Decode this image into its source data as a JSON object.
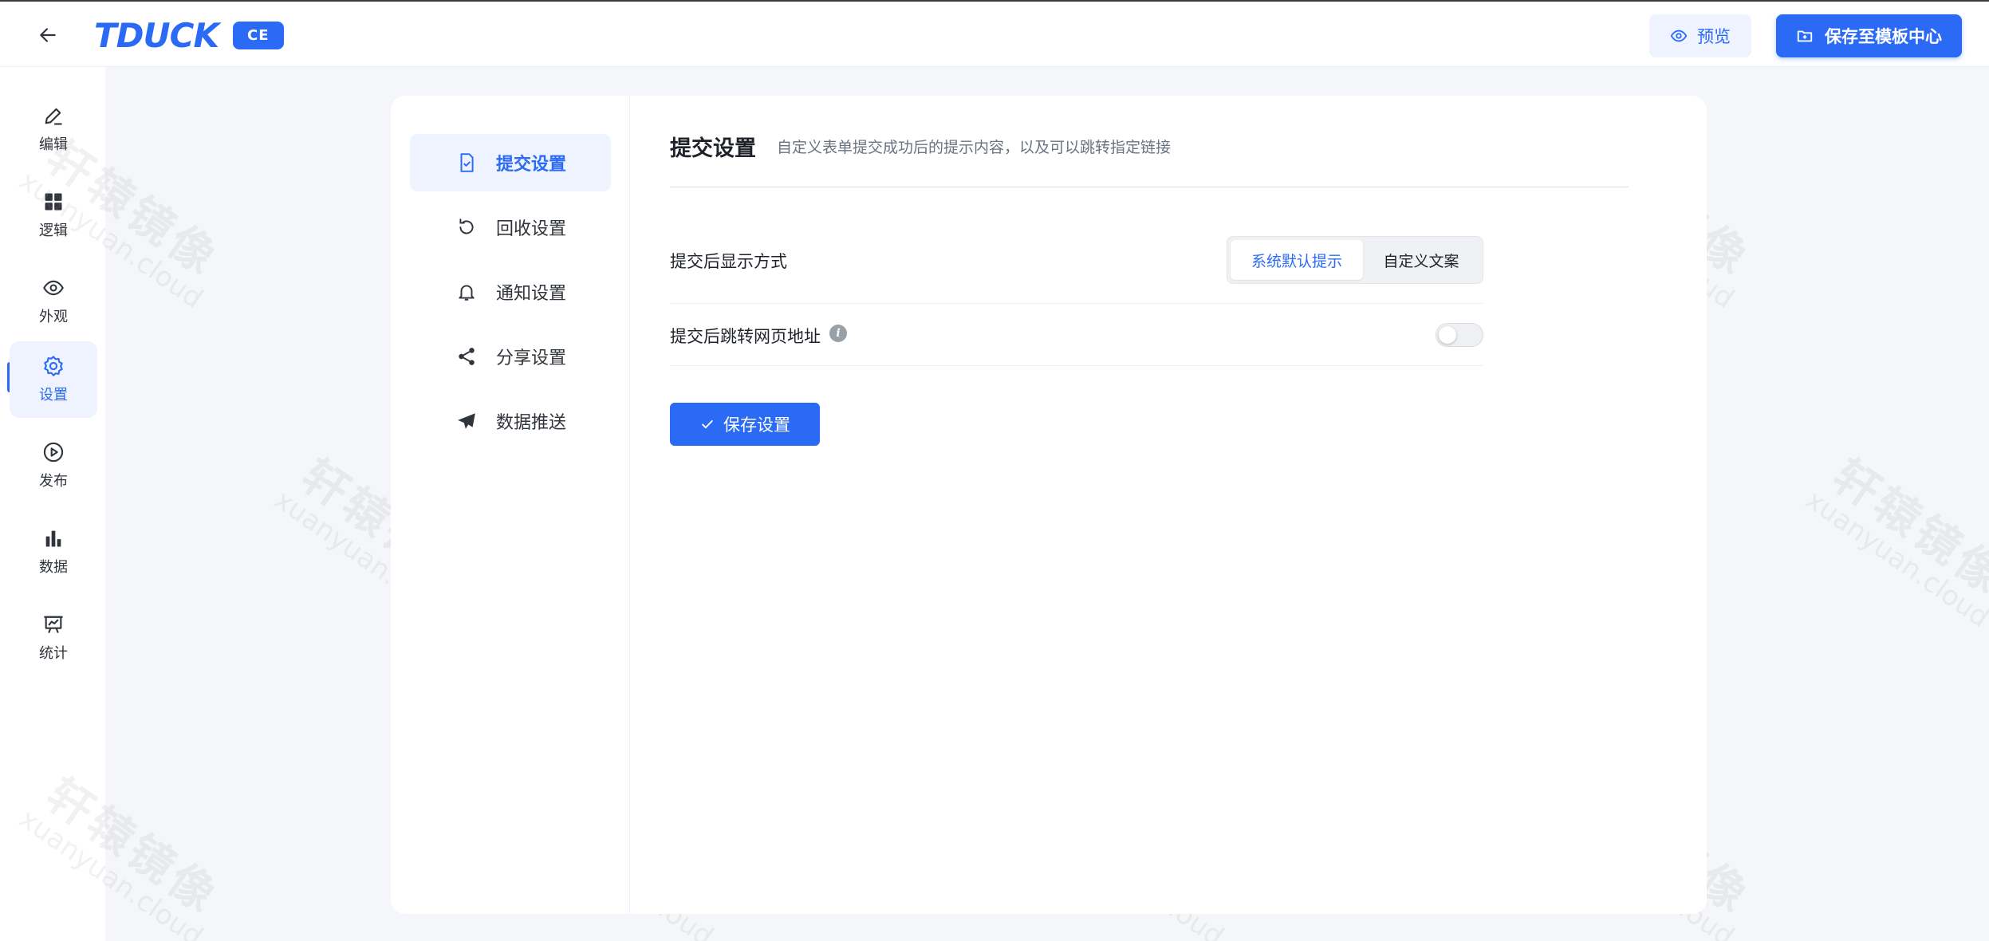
{
  "header": {
    "logo_text": "TDUCK",
    "logo_badge": "CE",
    "preview_label": "预览",
    "save_template_label": "保存至模板中心"
  },
  "sidebar": {
    "items": [
      {
        "label": "编辑",
        "icon": "pencil-icon"
      },
      {
        "label": "逻辑",
        "icon": "grid-icon"
      },
      {
        "label": "外观",
        "icon": "eye-icon"
      },
      {
        "label": "设置",
        "icon": "gear-icon",
        "active": true
      },
      {
        "label": "发布",
        "icon": "play-circle-icon"
      },
      {
        "label": "数据",
        "icon": "bar-chart-icon"
      },
      {
        "label": "统计",
        "icon": "presentation-icon"
      }
    ]
  },
  "subnav": {
    "items": [
      {
        "label": "提交设置",
        "icon": "file-check-icon",
        "active": true
      },
      {
        "label": "回收设置",
        "icon": "refresh-icon"
      },
      {
        "label": "通知设置",
        "icon": "bell-icon"
      },
      {
        "label": "分享设置",
        "icon": "share-icon"
      },
      {
        "label": "数据推送",
        "icon": "send-icon"
      }
    ]
  },
  "content": {
    "title": "提交设置",
    "description": "自定义表单提交成功后的提示内容，以及可以跳转指定链接",
    "display_mode_label": "提交后显示方式",
    "display_mode_options": [
      "系统默认提示",
      "自定义文案"
    ],
    "display_mode_selected": "系统默认提示",
    "redirect_label": "提交后跳转网页地址",
    "redirect_enabled": false,
    "save_button_label": "保存设置"
  },
  "watermark": {
    "cn": "轩辕镜像",
    "en": "xuanyuan.cloud"
  },
  "colors": {
    "accent": "#2b6af5",
    "accent_light": "#eef3ff"
  }
}
